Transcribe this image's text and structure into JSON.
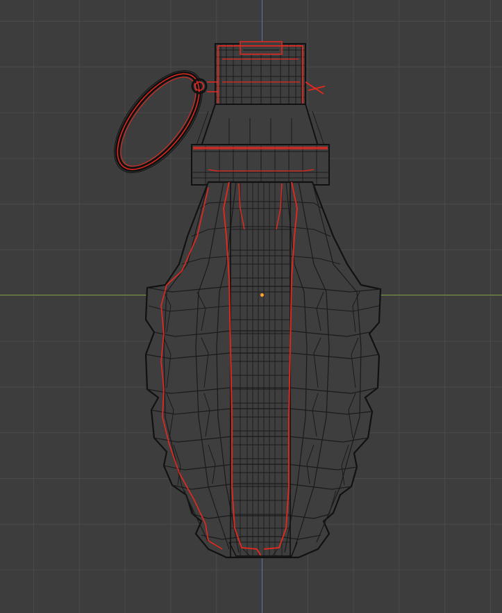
{
  "viewport": {
    "background": "#3d3d3d",
    "grid_color": "#4a4a4a",
    "x_axis_color": "#7a9a3e",
    "z_axis_color": "#5b78a8"
  },
  "object": {
    "wire_color": "#111111",
    "selected_outline_color": "#e8281e",
    "origin_color": "#ffa42a",
    "fuse_icon": "cylinder-icon",
    "ring_icon": "ring-icon",
    "body_icon": "pineapple-body-icon"
  }
}
